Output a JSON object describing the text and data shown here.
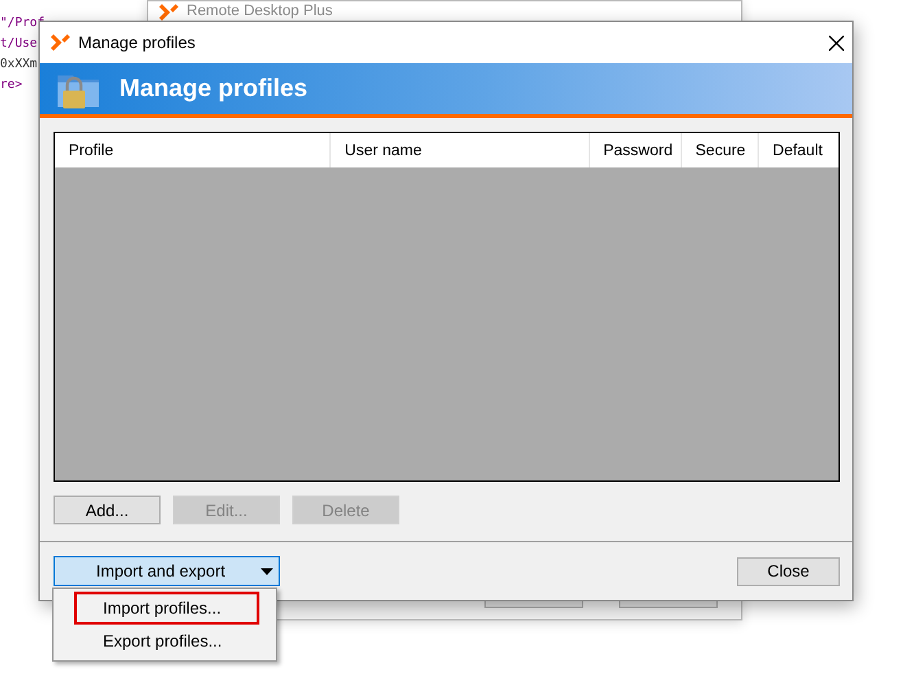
{
  "background_code": [
    "\"/Prof",
    "t/Use",
    "0xXXm",
    "re>"
  ],
  "background_window": {
    "title": "Remote Desktop Plus"
  },
  "dialog": {
    "title": "Manage profiles",
    "banner_title": "Manage profiles",
    "table": {
      "columns": [
        "Profile",
        "User name",
        "Password",
        "Secure",
        "Default"
      ]
    },
    "buttons": [
      {
        "label": "Add...",
        "disabled": false
      },
      {
        "label": "Edit...",
        "disabled": true
      },
      {
        "label": "Delete",
        "disabled": true
      }
    ],
    "import_export": {
      "label": "Import and export",
      "expanded": true
    },
    "close_button": "Close"
  },
  "menu": {
    "items": [
      {
        "label": "Import profiles...",
        "highlighted": true
      },
      {
        "label": "Export profiles...",
        "highlighted": false
      }
    ]
  }
}
